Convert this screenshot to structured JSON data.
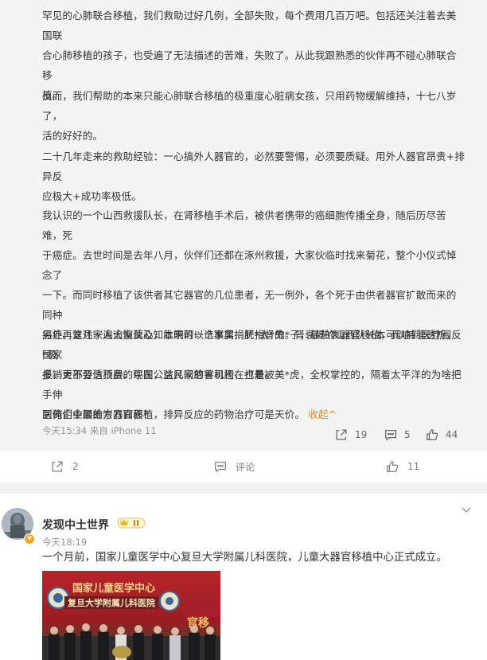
{
  "reply": {
    "paragraphs": [
      {
        "lines": [
          "罕见的心肺联合移植，我们救助过好几例，全部失败，每个费用几百万吧。包括还关注着去美国联",
          "合心肺移植的孩子，也受遍了无法描述的苦难，失败了。从此我跟熟悉的伙伴再不碰心肺联合移",
          "植。"
        ]
      },
      {
        "lines": [
          "反而，我们帮助的本来只能心肺联合移植的极重度心脏病女孩，只用药物缓解维持，十七八岁了，",
          "活的好好的。"
        ]
      },
      {
        "lines": [
          "二十几年走来的救助经验：一心搞外人器官的，必然要警惕，必须要质疑。用外人器官昂贵+排异反",
          "应极大+成功率极低。"
        ]
      },
      {
        "lines": [
          "我认识的一个山西救援队长，在肾移植手术后，被供者携带的癌细胞传播全身，随后历尽苦难，死",
          "于癌症。去世时间是去年八月，伙伴们还都在涿州救援，大家伙临时找来菊花，整个小仪式悼念了",
          "一下。而同时移植了该供者其它器官的几位患者，无一例外，各个死于由供者器官扩散而来的同种",
          "癌症。这几家人追悔莫及，本来可以选家属捐肝捐肾的。肾衰竭的山西队长本可以持续透析，国家",
          "报销大部分透析费。现在，这几家的官司还在打着。"
        ]
      },
      {
        "lines": [
          "另外再复述一遍大家伙心知肚明的一个事实：犹*太*鬼*子，最热衷器官移植，而咱们医疗圈反*极",
          "多。更不要信顶层的中国公益民间慈善机构，也是被美*虎，全权掌控的，隔着太平洋的为啥把手伸",
          "到俺们中国的方方面面？"
        ]
      },
      {
        "lines": [
          "医药企业最推崇器官移植，排异反应的药物治疗可是天价。"
        ],
        "fold": "收起^"
      }
    ],
    "meta": "今天15:34 来自 iPhone 11",
    "forward_count": "19",
    "comment_count": "5",
    "like_count": "44"
  },
  "post_actions": {
    "forward": "2",
    "comment": "评论",
    "like": "11"
  },
  "post": {
    "username": "发现中土世界",
    "rank": "II",
    "verified": "v",
    "time": "今天18:19",
    "text": "一个月前，国家儿童医学中心复旦大学附属儿科医院，儿童大器官移植中心正式成立。",
    "photo_title_1": "国家儿童医学中心",
    "photo_title_2": "复旦大学附属儿科医院"
  },
  "colors": {
    "accent_orange": "#ff8200",
    "meta_gray": "#939393",
    "reply_bg": "#f4f4f4"
  }
}
